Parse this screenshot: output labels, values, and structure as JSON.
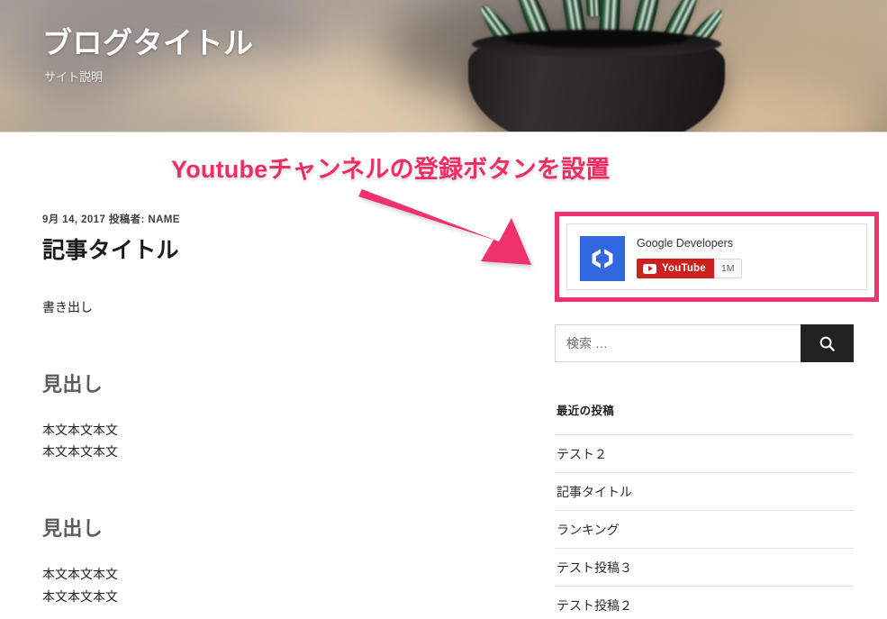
{
  "site": {
    "title": "ブログタイトル",
    "description": "サイト説明",
    "header_image": "blurred-potted-succulent-on-wooden-desk"
  },
  "annotation": {
    "text": "Youtubeチャンネルの登録ボタンを設置",
    "text_color": "#ef2d63",
    "arrow_color": "#f0336c",
    "highlight_border_color": "#f0336c",
    "arrow_icon": "arrow-down-right-icon"
  },
  "article": {
    "meta": "9月 14, 2017 投稿者: NAME",
    "title": "記事タイトル",
    "lead": "書き出し",
    "sections": [
      {
        "heading": "見出し",
        "paragraphs": [
          "本文本文本文",
          "本文本文本文"
        ]
      },
      {
        "heading": "見出し",
        "paragraphs": [
          "本文本文本文",
          "本文本文本文"
        ]
      }
    ]
  },
  "sidebar": {
    "youtube_widget": {
      "channel_name": "Google Developers",
      "avatar_icon": "google-developers-logo-icon",
      "avatar_bg": "#3367e0",
      "subscribe_label": "YouTube",
      "subscribe_bg": "#cd201f",
      "play_icon": "youtube-play-icon",
      "subscriber_count": "1M"
    },
    "search": {
      "placeholder": "検索 …",
      "value": "",
      "button_icon": "search-icon",
      "button_bg": "#222222"
    },
    "recent_posts": {
      "title": "最近の投稿",
      "items": [
        "テスト２",
        "記事タイトル",
        "ランキング",
        "テスト投稿３",
        "テスト投稿２"
      ]
    }
  }
}
